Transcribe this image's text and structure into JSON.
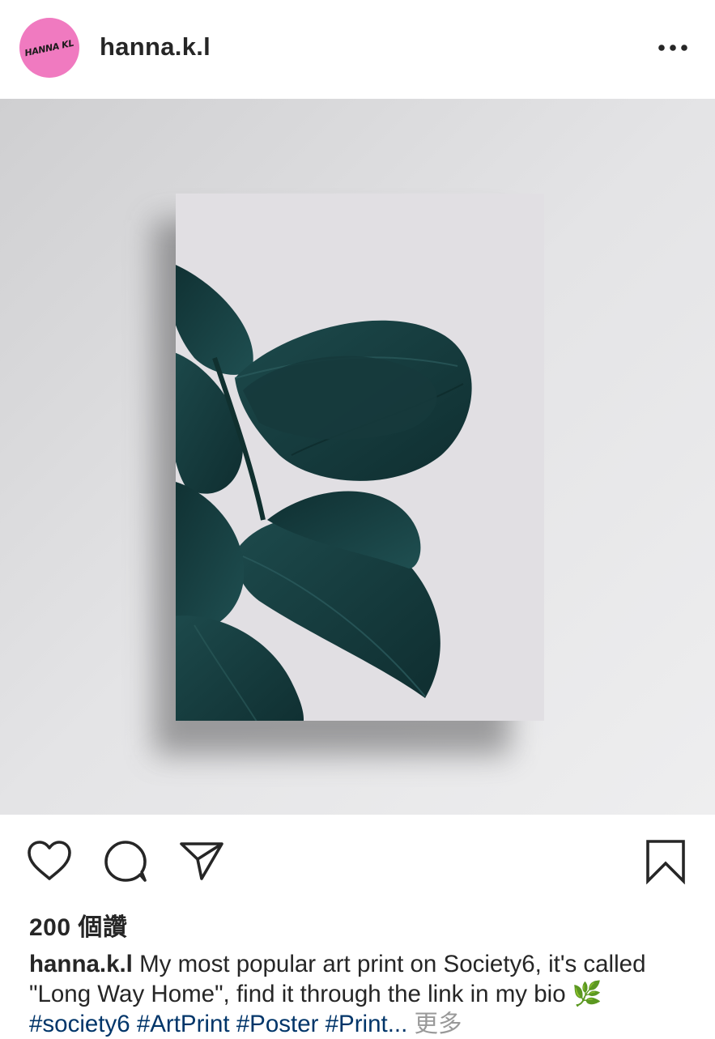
{
  "header": {
    "avatar_text": "HANNA KL",
    "username": "hanna.k.l",
    "more_icon": "ellipsis-icon"
  },
  "post": {
    "image_icon": "ficus-leaves-art-print",
    "colors": {
      "accent_avatar": "#f07ac0",
      "leaf": "#163a3c",
      "background": "#dcdcde",
      "hashtag": "#003569"
    }
  },
  "actions": {
    "like_icon": "heart-icon",
    "comment_icon": "comment-icon",
    "share_icon": "paper-plane-icon",
    "save_icon": "bookmark-icon"
  },
  "likes_text": "200 個讚",
  "caption": {
    "username": "hanna.k.l",
    "text": " My most popular art print on Society6, it's called \"Long Way Home\", find it through the link in my bio ",
    "emoji": "🌿",
    "hashtags": " #society6 #ArtPrint #Poster #Print...",
    "more": " 更多"
  }
}
